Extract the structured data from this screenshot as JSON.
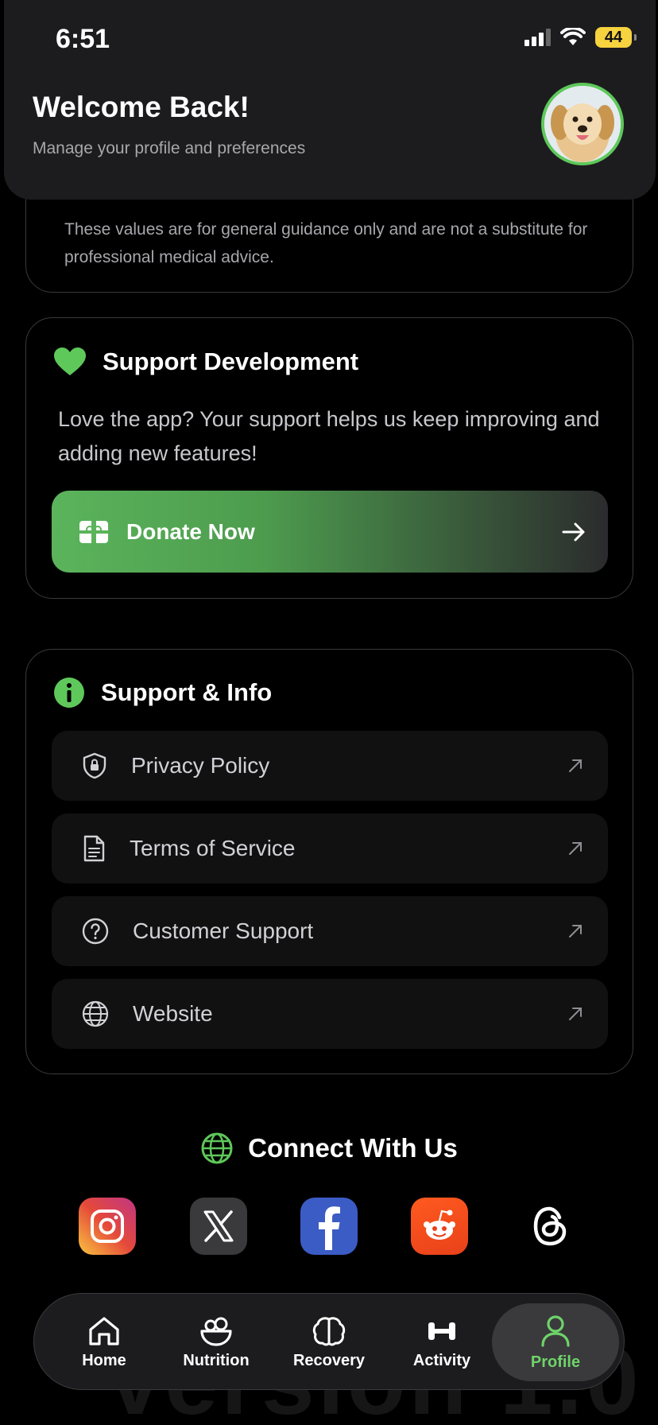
{
  "status_bar": {
    "time": "6:51",
    "battery": "44"
  },
  "header": {
    "title": "Welcome Back!",
    "subtitle": "Manage your profile and preferences"
  },
  "disclaimer": {
    "text": "These values are for general guidance only and are not a substitute for professional medical advice."
  },
  "support_development": {
    "title": "Support Development",
    "description": "Love the app? Your support helps us keep improving and adding new features!",
    "donate_label": "Donate Now"
  },
  "support_info": {
    "title": "Support & Info",
    "items": [
      {
        "label": "Privacy Policy",
        "icon": "shield-lock-icon"
      },
      {
        "label": "Terms of Service",
        "icon": "document-icon"
      },
      {
        "label": "Customer Support",
        "icon": "question-circle-icon"
      },
      {
        "label": "Website",
        "icon": "globe-icon"
      }
    ]
  },
  "connect": {
    "title": "Connect With Us",
    "socials": [
      "instagram-icon",
      "x-icon",
      "facebook-icon",
      "reddit-icon",
      "threads-icon"
    ]
  },
  "tabbar": {
    "items": [
      {
        "label": "Home"
      },
      {
        "label": "Nutrition"
      },
      {
        "label": "Recovery"
      },
      {
        "label": "Activity"
      },
      {
        "label": "Profile"
      }
    ],
    "active": "Profile"
  },
  "colors": {
    "accent": "#5ec85a",
    "background": "#000000",
    "card": "#1c1c1e"
  }
}
